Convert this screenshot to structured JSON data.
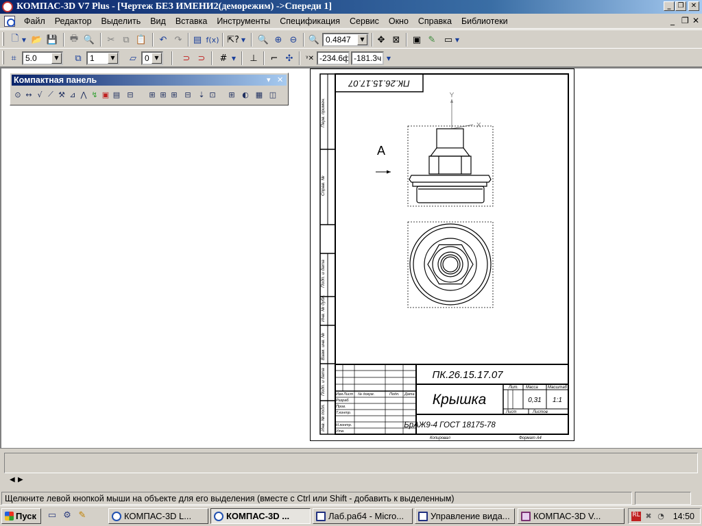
{
  "window": {
    "title": "КОМПАС-3D V7 Plus - [Чертеж БЕЗ ИМЕНИ2(деморежим) ->Спереди 1]"
  },
  "menu": {
    "items": [
      "Файл",
      "Редактор",
      "Выделить",
      "Вид",
      "Вставка",
      "Инструменты",
      "Спецификация",
      "Сервис",
      "Окно",
      "Справка",
      "Библиотеки"
    ]
  },
  "toolbar": {
    "zoom_value": "0.4847",
    "step_value": "5.0",
    "layer_value": "1",
    "style_value": "0",
    "coord_x": "-234.6ф",
    "coord_y": "-181.3ч"
  },
  "compact_panel": {
    "title": "Компактная панель"
  },
  "drawing": {
    "code_stamp": "ПК.26.15.17.07",
    "code_title": "ПК.26.15.17.07",
    "part_name": "Крышка",
    "material": "БрАЖ9-4  ГОСТ 18175-78",
    "view_label": "А",
    "axis_y": "Y",
    "axis_x": "X",
    "mass": "0,31",
    "scale": "1:1",
    "lit_label": "Лит.",
    "mass_label": "Масса",
    "scale_label": "Масштаб",
    "sheet_label": "Лист",
    "sheets_label": "Листов",
    "col_izm": "Изм",
    "col_list": "Лист",
    "col_doc": "№ докум.",
    "col_sign": "Подп.",
    "col_date": "Дата",
    "row_razrab": "Разраб.",
    "row_prov": "Пров.",
    "row_tkontr": "Т.контр.",
    "row_nkontr": "Н.контр.",
    "row_utv": "Утв.",
    "copied_label": "Копировал",
    "format_label": "Формат  А4",
    "side_perv": "Перв. примен.",
    "side_sprav": "Справ. №",
    "side_podp1": "Подп. и дата",
    "side_invdubl": "Инв. № дубл.",
    "side_vzam": "Взам. инв. №",
    "side_podp2": "Подп. и дата",
    "side_invpodl": "Инв. № подл."
  },
  "status": {
    "message": "Щелкните левой кнопкой мыши на объекте для его выделения (вместе с Ctrl или Shift - добавить к выделенным)"
  },
  "taskbar": {
    "start_label": "Пуск",
    "tasks": [
      "КОМПАС-3D L...",
      "КОМПАС-3D ...",
      "Лаб.раб4 - Micro...",
      "Управление вида...",
      "КОМПАС-3D V..."
    ],
    "tray_rl": "RL",
    "clock": "14:50"
  }
}
